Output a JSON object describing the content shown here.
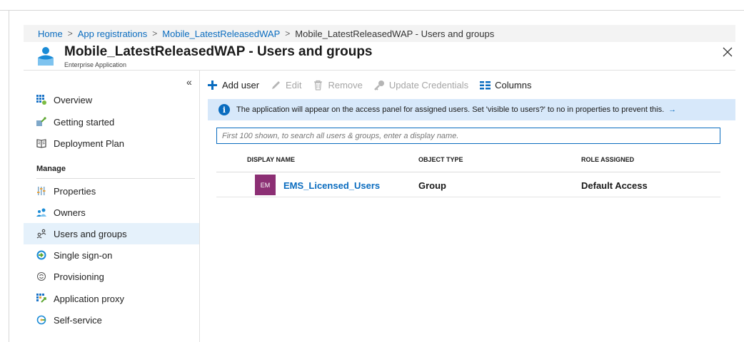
{
  "breadcrumb": {
    "items": [
      "Home",
      "App registrations",
      "Mobile_LatestReleasedWAP"
    ],
    "current": "Mobile_LatestReleasedWAP - Users and groups",
    "separator": ">"
  },
  "header": {
    "title": "Mobile_LatestReleasedWAP - Users and groups",
    "subtitle": "Enterprise Application",
    "icon": "enterprise-app-icon",
    "close_icon": "close-icon"
  },
  "sidebar": {
    "collapse_label": "«",
    "items": [
      {
        "label": "Overview",
        "icon": "overview-icon"
      },
      {
        "label": "Getting started",
        "icon": "rocket-icon"
      },
      {
        "label": "Deployment Plan",
        "icon": "book-icon"
      }
    ],
    "section_title": "Manage",
    "manage_items": [
      {
        "label": "Properties",
        "icon": "properties-icon"
      },
      {
        "label": "Owners",
        "icon": "owners-icon"
      },
      {
        "label": "Users and groups",
        "icon": "users-groups-icon",
        "active": true
      },
      {
        "label": "Single sign-on",
        "icon": "sso-icon"
      },
      {
        "label": "Provisioning",
        "icon": "provisioning-icon"
      },
      {
        "label": "Application proxy",
        "icon": "app-proxy-icon"
      },
      {
        "label": "Self-service",
        "icon": "self-service-icon"
      }
    ]
  },
  "toolbar": {
    "add_user": "Add user",
    "edit": "Edit",
    "remove": "Remove",
    "update_credentials": "Update Credentials",
    "columns": "Columns"
  },
  "info_banner": {
    "text": "The application will appear on the access panel for assigned users. Set 'visible to users?' to no in properties to prevent this.",
    "arrow": "→"
  },
  "search": {
    "placeholder": "First 100 shown, to search all users & groups, enter a display name."
  },
  "table": {
    "columns": [
      "DISPLAY NAME",
      "OBJECT TYPE",
      "ROLE ASSIGNED"
    ],
    "rows": [
      {
        "avatar_initials": "EM",
        "display_name": "EMS_Licensed_Users",
        "object_type": "Group",
        "role_assigned": "Default Access"
      }
    ]
  },
  "colors": {
    "accent": "#0a6cbf",
    "active_nav": "#e5f1fb",
    "info_banner": "#d7e8fa",
    "avatar": "#8c2f74",
    "add_icon": "#0a6cbf"
  }
}
